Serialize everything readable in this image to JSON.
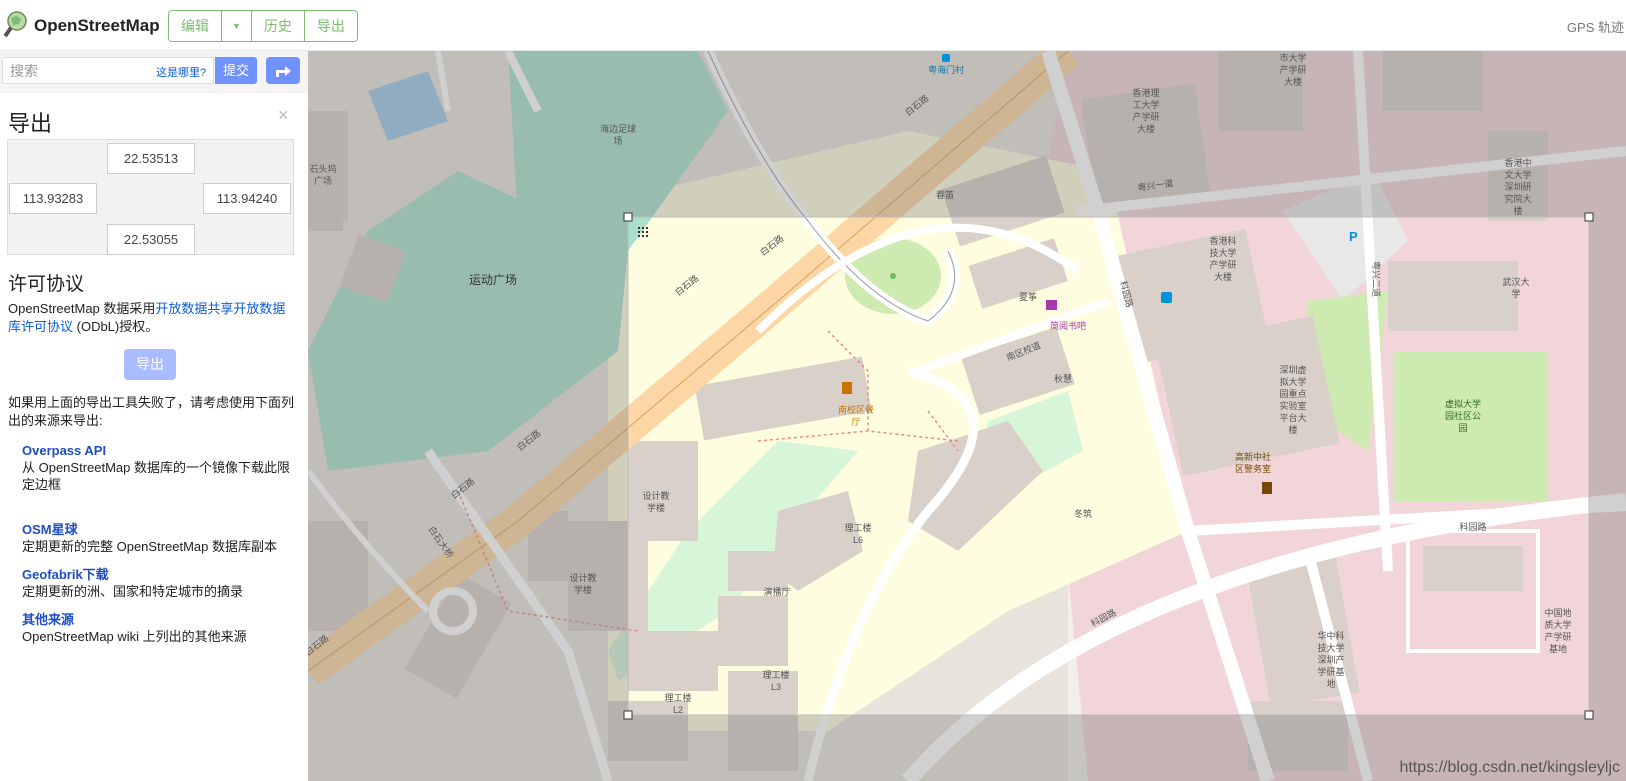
{
  "header": {
    "brand": "OpenStreetMap",
    "buttons": {
      "edit": "编辑",
      "history": "历史",
      "export": "导出"
    },
    "gps": "GPS 轨迹"
  },
  "search": {
    "placeholder": "搜索",
    "where": "这是哪里?",
    "submit": "提交"
  },
  "export_panel": {
    "title": "导出",
    "close": "×",
    "bbox": {
      "north": "22.53513",
      "west": "113.93283",
      "east": "113.94240",
      "south": "22.53055"
    },
    "license_title": "许可协议",
    "license_pre": "OpenStreetMap 数据采用",
    "license_link": "开放数据共享开放数据库许可协议",
    "license_post": " (ODbL)授权。",
    "export_button": "导出",
    "fallback_text": "如果用上面的导出工具失败了，请考虑使用下面列出的来源来导出:",
    "sources": [
      {
        "title": "Overpass API",
        "desc": "从 OpenStreetMap 数据库的一个镜像下载此限定边框"
      },
      {
        "title": "OSM星球",
        "desc": "定期更新的完整 OpenStreetMap 数据库副本"
      },
      {
        "title": "Geofabrik下载",
        "desc": "定期更新的洲、国家和特定城市的摘录"
      },
      {
        "title": "其他来源",
        "desc": "OpenStreetMap wiki 上列出的其他来源"
      }
    ]
  },
  "map": {
    "labels": {
      "yuehaimen": "粤海门村",
      "soccer_field_1": "海边足球",
      "soccer_field_2": "场",
      "sports_plaza": "运动广场",
      "stone_plaza_1": "石头坞",
      "stone_plaza_2": "广场",
      "baishi_road": "白石路",
      "chunlei": "春笛",
      "xiaxun": "夏筝",
      "jianyue": "简阅书吧",
      "nanqu_road": "南区校道",
      "qiuhui": "秋慧",
      "dongzhu": "冬筑",
      "canteen_1": "南校区餐",
      "canteen_2": "厅",
      "design_1_a": "设计教",
      "design_1_b": "学楼",
      "design_2_a": "设计教",
      "design_2_b": "学楼",
      "l6_a": "理工楼",
      "l6_b": "L6",
      "theater": "演播厅",
      "l3_a": "理工楼",
      "l3_b": "L3",
      "l2_a": "理工楼",
      "l2_b": "L2",
      "baishi_bridge": "白石大桥",
      "keyuan_road": "科园路",
      "keyuan_road_2": "科园路",
      "hkust_1": "香港科",
      "hkust_2": "技大学",
      "hkust_3": "产学研",
      "hkust_4": "大楼",
      "hkpoly_1": "香港理",
      "hkpoly_2": "工大学",
      "hkpoly_3": "产学研",
      "hkpoly_4": "大楼",
      "cityu_1": "市大学",
      "cityu_2": "产学研",
      "cityu_3": "大楼",
      "cuhk_1": "香港中",
      "cuhk_2": "文大学",
      "cuhk_3": "深圳研",
      "cuhk_4": "究院大",
      "cuhk_5": "楼",
      "yuexing1": "粤兴一道",
      "yuexing2": "粤兴二道",
      "whu_1": "武汉大",
      "whu_2": "学",
      "vu_lab_1": "深圳虚",
      "vu_lab_2": "拟大学",
      "vu_lab_3": "园重点",
      "vu_lab_4": "实验室",
      "vu_lab_5": "平台大",
      "vu_lab_6": "楼",
      "vu_park_1": "虚拟大学",
      "vu_park_2": "园社区公",
      "vu_park_3": "园",
      "police_1": "高新中社",
      "police_2": "区警务室",
      "cug_1": "中国地",
      "cug_2": "质大学",
      "cug_3": "产学研",
      "cug_4": "基地",
      "hust_1": "华中科",
      "hust_2": "技大学",
      "hust_3": "深圳产",
      "hust_4": "学研基",
      "hust_5": "地",
      "parking": "P"
    },
    "watermark": "https://blog.csdn.net/kingsleyljc"
  },
  "colors": {
    "osm_green": "#7ebc6f",
    "submit_blue": "#7092ff",
    "link_blue": "#0b5ed7",
    "campus_yellow": "#fffde0",
    "campus_pink": "#f2d5d8",
    "building": "#d9d0c9",
    "park_green": "#cdebb0",
    "pitch_green": "#aae0cb",
    "road_orange": "#fcd6a4"
  }
}
